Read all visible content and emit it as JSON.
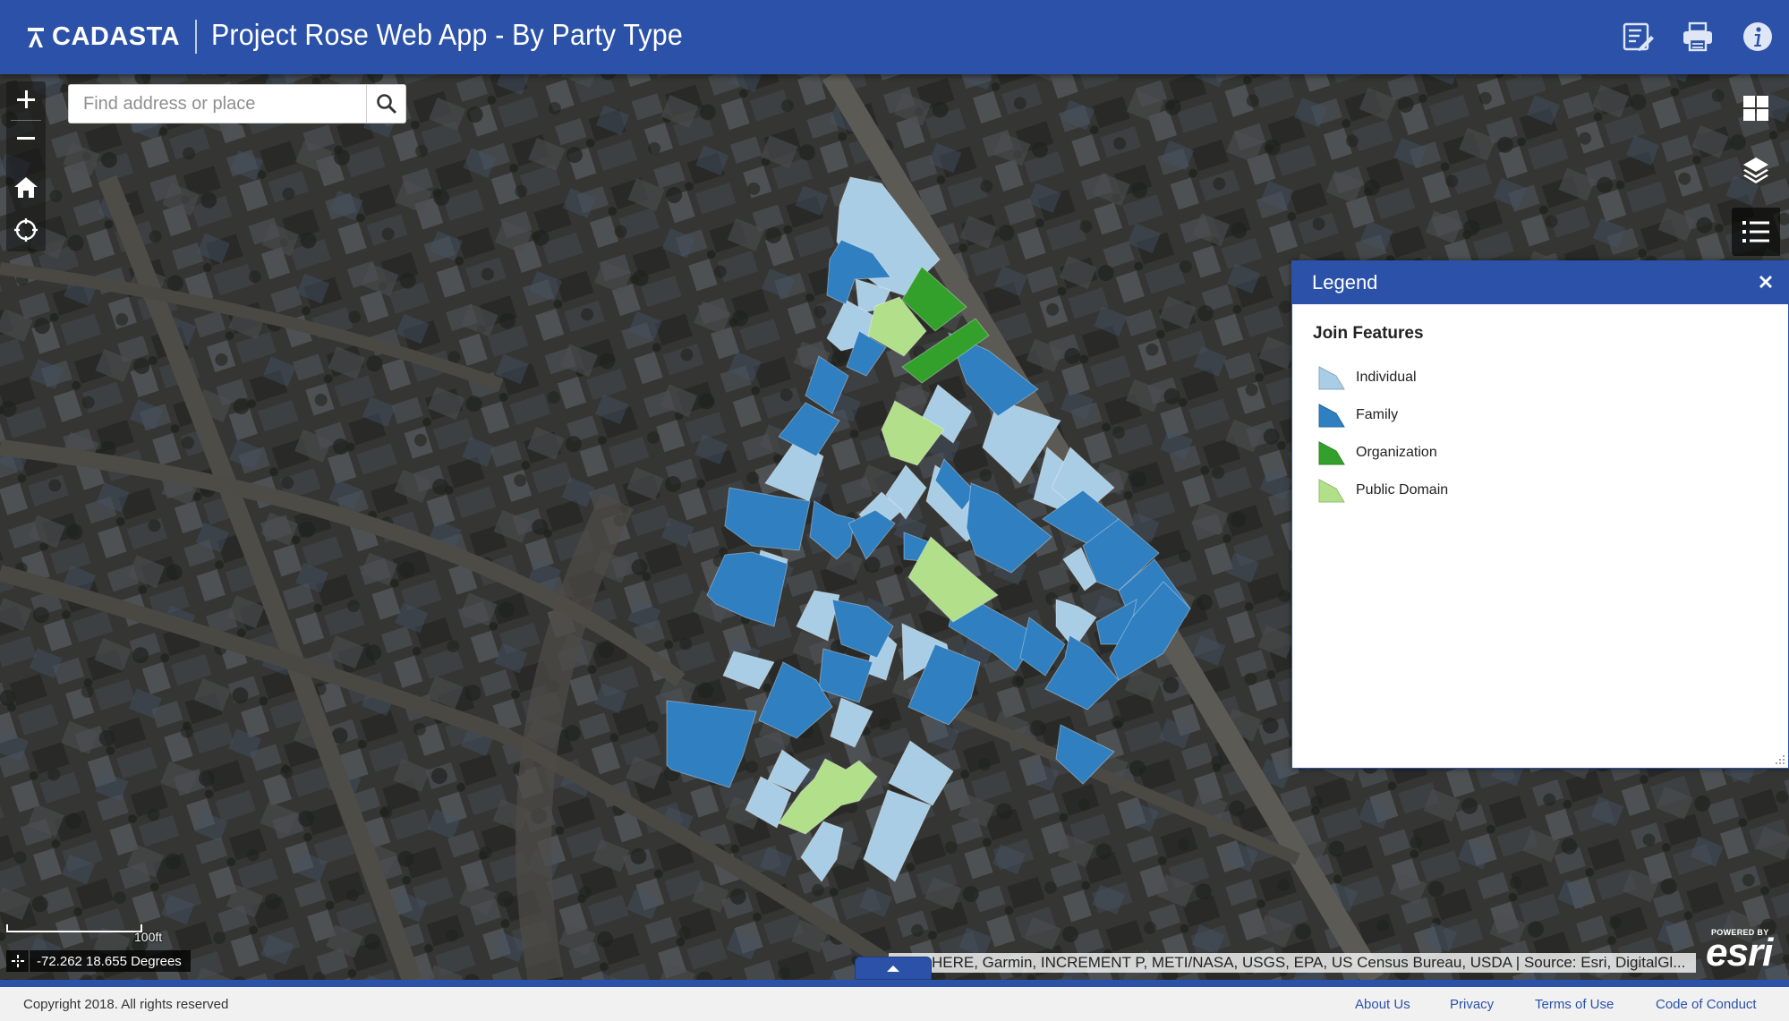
{
  "header": {
    "logo_text": "CADASTA",
    "title": "Project Rose Web App - By Party Type",
    "buttons": [
      {
        "name": "edit-icon"
      },
      {
        "name": "print-icon"
      },
      {
        "name": "info-icon"
      }
    ]
  },
  "map_controls": {
    "zoom_in": "plus-icon",
    "zoom_out": "minus-icon",
    "home": "home-icon",
    "locate": "locate-icon"
  },
  "search": {
    "placeholder": "Find address or place",
    "value": ""
  },
  "right_tools": [
    {
      "name": "basemap-gallery-icon"
    },
    {
      "name": "layers-icon"
    },
    {
      "name": "legend-list-icon",
      "active": true
    }
  ],
  "legend": {
    "title": "Legend",
    "layer_name": "Join Features",
    "items": [
      {
        "label": "Individual",
        "color": "#a9cde5"
      },
      {
        "label": "Family",
        "color": "#2f7fc1"
      },
      {
        "label": "Organization",
        "color": "#33a02c"
      },
      {
        "label": "Public Domain",
        "color": "#b2df8a"
      }
    ]
  },
  "scalebar": {
    "label": "100ft"
  },
  "coordinates": {
    "text": "-72.262 18.655 Degrees"
  },
  "attribution": {
    "text": "HERE, Garmin, INCREMENT P, METI/NASA, USGS, EPA, US Census Bureau, USDA | Source: Esri, DigitalGl..."
  },
  "esri": {
    "powered_by": "POWERED BY",
    "brand": "esri"
  },
  "footer": {
    "copyright": "Copyright 2018. All rights reserved",
    "links": [
      "About Us",
      "Privacy",
      "Terms of Use",
      "Code of Conduct"
    ]
  },
  "colors": {
    "header_blue": "#2b52a8",
    "individual": "#a9cde5",
    "family": "#2f7fc1",
    "organization": "#33a02c",
    "public_domain": "#b2df8a"
  }
}
